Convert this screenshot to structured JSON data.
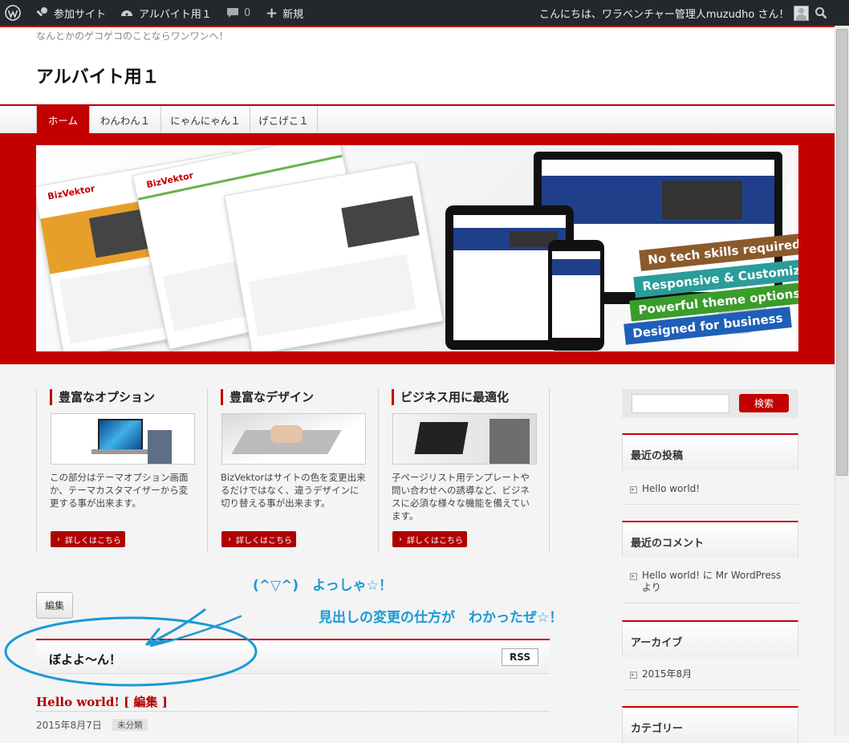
{
  "adminbar": {
    "site_link": "参加サイト",
    "site_name": "アルバイト用１",
    "comments_count": "0",
    "new_label": "新規",
    "greeting": "こんにちは、ワラベンチャー管理人muzudho さん！"
  },
  "header": {
    "tagline": "なんとかのゲコゲコのことならワンワンへ！",
    "site_title": "アルバイト用１"
  },
  "nav": {
    "items": [
      {
        "label": "ホーム"
      },
      {
        "label": "わんわん１"
      },
      {
        "label": "にゃんにゃん１"
      },
      {
        "label": "げこげこ１"
      }
    ]
  },
  "hero": {
    "logo_text": "BizVektor",
    "ribbons": [
      "No tech skills required",
      "Responsive & Customizable",
      "Powerful theme options",
      "Designed for business"
    ],
    "ribbon_colors": [
      "#8b5a2b",
      "#2a9d9a",
      "#3a9c2a",
      "#1f5fb8"
    ]
  },
  "features": [
    {
      "title": "豊富なオプション",
      "text": "この部分はテーマオプション画面か、テーマカスタマイザーから変更する事が出来ます。",
      "button": "詳しくはこちら"
    },
    {
      "title": "豊富なデザイン",
      "text": "BizVektorはサイトの色を変更出来るだけではなく、違うデザインに切り替える事が出来ます。",
      "button": "詳しくはこちら"
    },
    {
      "title": "ビジネス用に最適化",
      "text": "子ページリスト用テンプレートや問い合わせへの誘導など、ビジネスに必須な様々な機能を備えています。",
      "button": "詳しくはこちら"
    }
  ],
  "content": {
    "edit_label": "編集",
    "annotation_line1": "(^▽^)　よっしゃ☆！",
    "annotation_line2": "見出しの変更の仕方が　わかったぜ☆！",
    "section_title": "ぼよよ〜ん！",
    "rss_label": "RSS",
    "post_title": "Hello world! [ 編集 ]",
    "post_date": "2015年8月7日",
    "post_category": "未分類"
  },
  "sidebar": {
    "search_button": "検索",
    "recent_posts_title": "最近の投稿",
    "recent_posts": [
      "Hello world!"
    ],
    "recent_comments_title": "最近のコメント",
    "recent_comment_line1": "Hello world! に Mr WordPress",
    "recent_comment_line2": "より",
    "archives_title": "アーカイブ",
    "archives": [
      "2015年8月"
    ],
    "categories_title": "カテゴリー"
  },
  "colors": {
    "accent": "#c30000",
    "admin_bar": "#23282d",
    "annotation": "#1a9ad6"
  }
}
